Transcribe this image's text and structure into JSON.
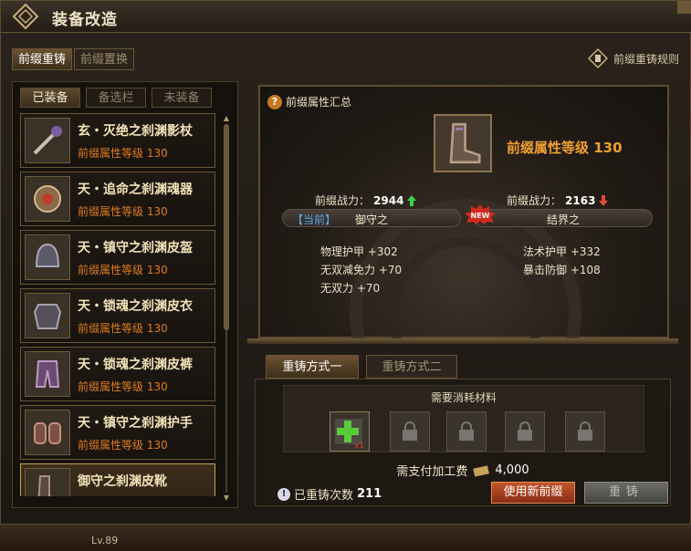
{
  "window": {
    "title": "装备改造"
  },
  "top_tabs": [
    {
      "label": "前缀重铸"
    },
    {
      "label": "前缀置换"
    }
  ],
  "rules_link": "前缀重铸规则",
  "left_tabs": [
    {
      "label": "已装备"
    },
    {
      "label": "备选栏"
    },
    {
      "label": "未装备"
    }
  ],
  "items": [
    {
      "name": "玄・灭绝之刹渊影杖",
      "level_text": "前缀属性等级 130",
      "icon": "staff-icon"
    },
    {
      "name": "天・追命之刹渊魂器",
      "level_text": "前缀属性等级 130",
      "icon": "soul-orb-icon"
    },
    {
      "name": "天・镇守之刹渊皮盔",
      "level_text": "前缀属性等级 130",
      "icon": "helmet-icon"
    },
    {
      "name": "天・锁魂之刹渊皮衣",
      "level_text": "前缀属性等级 130",
      "icon": "armor-icon"
    },
    {
      "name": "天・锁魂之刹渊皮裤",
      "level_text": "前缀属性等级 130",
      "icon": "pants-icon"
    },
    {
      "name": "天・镇守之刹渊护手",
      "level_text": "前缀属性等级 130",
      "icon": "gloves-icon"
    },
    {
      "name": "御守之刹渊皮靴",
      "level_text": "",
      "icon": "boots-icon"
    }
  ],
  "summary": {
    "header": "前缀属性汇总",
    "title": "前缀属性等级 130",
    "current": {
      "power_label": "前缀战力：",
      "power": "2944",
      "tag": "【当前】",
      "prefix": "御守之",
      "stats": [
        "物理护甲 +302",
        "无双减免力 +70",
        "无双力 +70"
      ]
    },
    "new": {
      "power_label": "前缀战力：",
      "power": "2163",
      "prefix": "结界之",
      "badge": "NEW",
      "stats": [
        "法术护甲 +332",
        "暴击防御 +108"
      ]
    }
  },
  "method_tabs": [
    {
      "label": "重铸方式一"
    },
    {
      "label": "重铸方式二"
    }
  ],
  "materials": {
    "label": "需要消耗材料",
    "first_slot_count": "x1",
    "cost_label": "需支付加工费",
    "cost_value": "4,000"
  },
  "reforge_times_label": "已重铸次数",
  "reforge_times": "211",
  "buttons": {
    "use_new": "使用新前缀",
    "reforge": "重铸"
  },
  "footer": {
    "level": "Lv.89"
  },
  "colors": {
    "accent_orange": "#e07b1e",
    "gold": "#f0a030",
    "up": "#3fd04a",
    "down": "#e04a3a",
    "new_badge": "#d12a1c"
  }
}
